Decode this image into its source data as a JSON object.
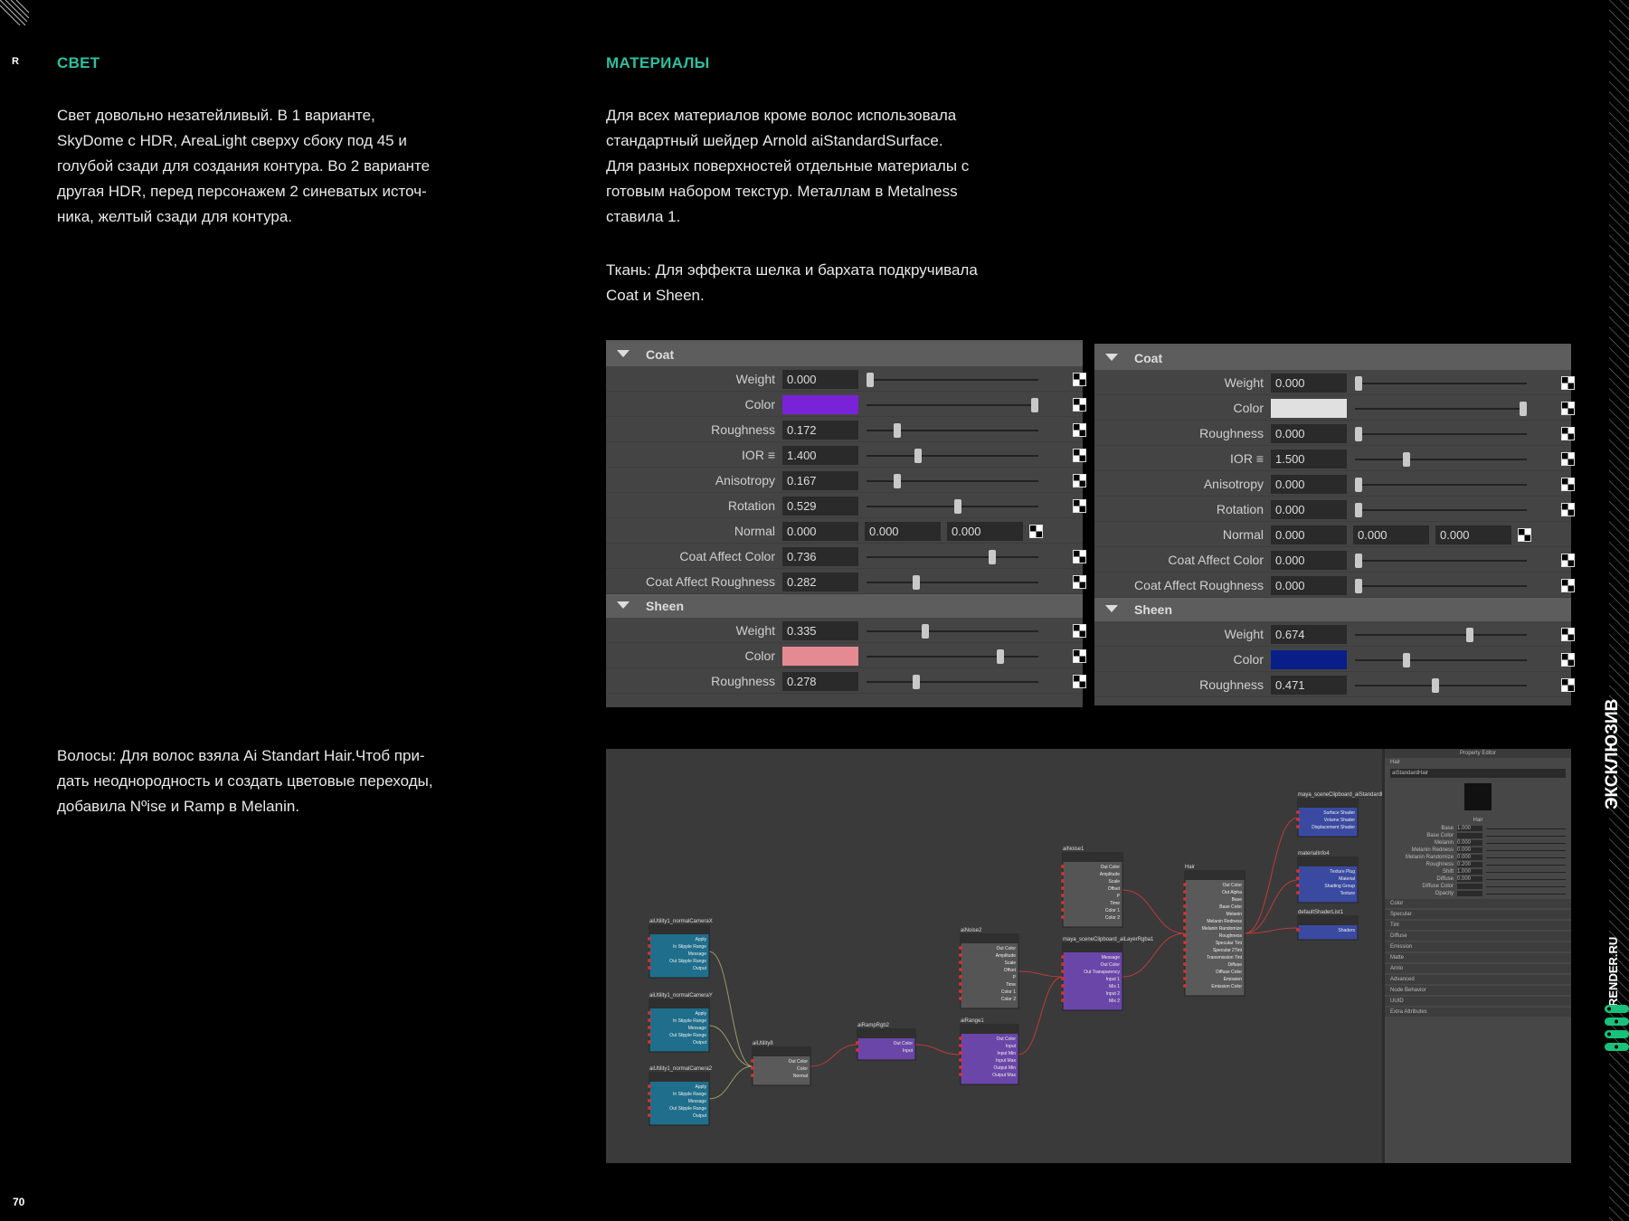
{
  "corner": {
    "mark": "R",
    "page_number": "70"
  },
  "left_column": {
    "light_heading": "СВЕТ",
    "light_text_lines": [
      "Свет довольно незатейливый. В 1 варианте,",
      "SkyDome с HDR, AreaLight сверху сбоку под 45 и",
      "голубой сзади для создания контура. Во 2 варианте",
      "другая HDR, перед персонажем 2 синеватых источ-",
      "ника, желтый сзади для контура."
    ],
    "hair_text_lines": [
      "Волосы: Для волос взяла Ai Standart Hair.Чтоб при-",
      "дать неоднородность и создать цветовые переходы,",
      "добавила Nºise и Ramp в Melanin."
    ]
  },
  "right_column": {
    "materials_heading": "МАТЕРИАЛЫ",
    "materials_text_lines": [
      "Для всех материалов кроме волос использовала",
      "стандартный шейдер Arnold aiStandardSurface.",
      "Для разных поверхностей отдельные материалы с",
      "готовым набором текстур. Металлам в Metalness",
      "ставила 1."
    ],
    "fabric_text_lines": [
      "Ткань: Для эффекта шелка и бархата подкручивала",
      "Coat и Sheen."
    ]
  },
  "panels": [
    {
      "coat_label": "Coat",
      "coat": [
        {
          "label": "Weight",
          "value": "0.000",
          "slider": 0.02
        },
        {
          "label": "Color",
          "swatch": "#7a22d8",
          "slider": 0.98
        },
        {
          "label": "Roughness",
          "value": "0.172",
          "slider": 0.18
        },
        {
          "label": "IOR ≡",
          "value": "1.400",
          "slider": 0.3
        },
        {
          "label": "Anisotropy",
          "value": "0.167",
          "slider": 0.18
        },
        {
          "label": "Rotation",
          "value": "0.529",
          "slider": 0.53
        },
        {
          "label": "Normal",
          "vector": [
            "0.000",
            "0.000",
            "0.000"
          ]
        },
        {
          "label": "Coat Affect Color",
          "value": "0.736",
          "slider": 0.73
        },
        {
          "label": "Coat Affect Roughness",
          "value": "0.282",
          "slider": 0.29
        }
      ],
      "sheen_label": "Sheen",
      "sheen": [
        {
          "label": "Weight",
          "value": "0.335",
          "slider": 0.34
        },
        {
          "label": "Color",
          "swatch": "#e58a93",
          "slider": 0.78
        },
        {
          "label": "Roughness",
          "value": "0.278",
          "slider": 0.29
        }
      ]
    },
    {
      "coat_label": "Coat",
      "coat": [
        {
          "label": "Weight",
          "value": "0.000",
          "slider": 0.02
        },
        {
          "label": "Color",
          "swatch": "#e0e0e0",
          "slider": 0.98
        },
        {
          "label": "Roughness",
          "value": "0.000",
          "slider": 0.02
        },
        {
          "label": "IOR ≡",
          "value": "1.500",
          "slider": 0.3
        },
        {
          "label": "Anisotropy",
          "value": "0.000",
          "slider": 0.02
        },
        {
          "label": "Rotation",
          "value": "0.000",
          "slider": 0.02
        },
        {
          "label": "Normal",
          "vector": [
            "0.000",
            "0.000",
            "0.000"
          ]
        },
        {
          "label": "Coat Affect Color",
          "value": "0.000",
          "slider": 0.02
        },
        {
          "label": "Coat Affect Roughness",
          "value": "0.000",
          "slider": 0.02
        }
      ],
      "sheen_label": "Sheen",
      "sheen": [
        {
          "label": "Weight",
          "value": "0.674",
          "slider": 0.67
        },
        {
          "label": "Color",
          "swatch": "#0a1e8a",
          "slider": 0.3
        },
        {
          "label": "Roughness",
          "value": "0.471",
          "slider": 0.47
        }
      ]
    }
  ],
  "node_editor": {
    "nodes": [
      {
        "title": "aiUtility1_normalCameraX",
        "color": "#1f6e8c",
        "ports": [
          "Apply",
          "In Stipple Range",
          "Message",
          "Out Stipple Range",
          "Output"
        ]
      },
      {
        "title": "aiUtility1_normalCameraY",
        "color": "#1f6e8c",
        "ports": [
          "Apply",
          "In Stipple Range",
          "Message",
          "Out Stipple Range",
          "Output"
        ]
      },
      {
        "title": "aiUtility1_normalCamera2",
        "color": "#1f6e8c",
        "ports": [
          "Apply",
          "In Stipple Range",
          "Message",
          "Out Stipple Range",
          "Output"
        ]
      },
      {
        "title": "aiUtility8",
        "color": "#5a5a5a",
        "ports": [
          "Out Color",
          "Color",
          "Normal"
        ]
      },
      {
        "title": "aiRampRgb2",
        "color": "#6a46a8",
        "ports": [
          "Out Color",
          "Input"
        ]
      },
      {
        "title": "aiNoise2",
        "color": "#555555",
        "ports": [
          "Out Color",
          "Amplitude",
          "Scale",
          "Offset",
          "P",
          "Time",
          "Color 1",
          "Color 2"
        ]
      },
      {
        "title": "aiRange1",
        "color": "#6a46a8",
        "ports": [
          "Out Color",
          "Input",
          "Input Min",
          "Input Max",
          "Output Min",
          "Output Max"
        ]
      },
      {
        "title": "aiNoise1",
        "color": "#555555",
        "ports": [
          "Out Color",
          "Amplitude",
          "Scale",
          "Offset",
          "P",
          "Time",
          "Color 1",
          "Color 2"
        ]
      },
      {
        "title": "maya_sceneClipboard_aiLayerRgba1",
        "color": "#6a46a8",
        "ports": [
          "Message",
          "Out Color",
          "Out Transparency",
          "Input 1",
          "Mix 1",
          "Input 2",
          "Mix 2"
        ]
      },
      {
        "title": "Hair",
        "color": "#5a5a5a",
        "ports": [
          "Out Color",
          "Out Alpha",
          "Base",
          "Base Color",
          "Melanin",
          "Melanin Redness",
          "Melanin Randomize",
          "Roughness",
          "Specular Tint",
          "Specular 2Tint",
          "Transmission Tint",
          "Diffuse",
          "Diffuse Color",
          "Emission",
          "Emission Color"
        ]
      },
      {
        "title": "maya_sceneClipboard_aiStandardHair11",
        "color": "#3a4aa0",
        "ports": [
          "Surface Shader",
          "Volume Shader",
          "Displacement Shader"
        ]
      },
      {
        "title": "materialInfo4",
        "color": "#3a4aa0",
        "ports": [
          "Texture Plug",
          "Material",
          "Shading Group",
          "Texture"
        ]
      },
      {
        "title": "defaultShaderList1",
        "color": "#3a4aa0",
        "ports": [
          "Shaders"
        ]
      }
    ],
    "property_editor": {
      "title": "Property Editor",
      "node_label": "Hair",
      "type_field": "aiStandardHair",
      "type_value": "Hair",
      "sections": [
        "Color",
        "Specular",
        "Tint",
        "Diffuse",
        "Emission",
        "Matte",
        "Arnlo",
        "Advanced",
        "Node Behavior",
        "UUID",
        "Extra Attributes"
      ],
      "rows": [
        {
          "label": "Base",
          "value": "1.000"
        },
        {
          "label": "Base Color",
          "value": ""
        },
        {
          "label": "Melanin",
          "value": "0.000"
        },
        {
          "label": "Melanin Redness",
          "value": "0.000"
        },
        {
          "label": "Melanin Randomize",
          "value": "0.000"
        },
        {
          "label": "Roughness",
          "value": "0.200"
        },
        {
          "label": "Shift",
          "value": "1.000"
        },
        {
          "label": "Diffuse",
          "value": "0.000"
        },
        {
          "label": "Diffuse Color",
          "value": ""
        },
        {
          "label": "Opacity",
          "value": ""
        }
      ]
    }
  },
  "side_labels": {
    "exclusive": "ЭКСКЛЮЗИВ",
    "brand": "RENDER.RU"
  }
}
